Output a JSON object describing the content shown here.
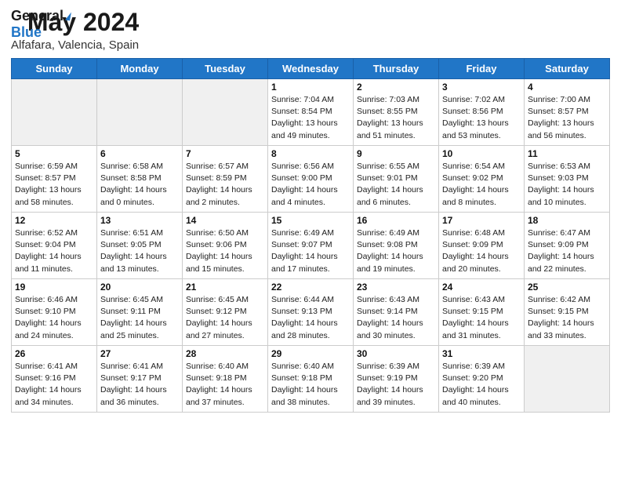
{
  "header": {
    "logo_general": "General",
    "logo_blue": "Blue",
    "title": "May 2024",
    "subtitle": "Alfafara, Valencia, Spain"
  },
  "calendar": {
    "days_of_week": [
      "Sunday",
      "Monday",
      "Tuesday",
      "Wednesday",
      "Thursday",
      "Friday",
      "Saturday"
    ],
    "weeks": [
      [
        {
          "day": "",
          "info": ""
        },
        {
          "day": "",
          "info": ""
        },
        {
          "day": "",
          "info": ""
        },
        {
          "day": "1",
          "info": "Sunrise: 7:04 AM\nSunset: 8:54 PM\nDaylight: 13 hours\nand 49 minutes."
        },
        {
          "day": "2",
          "info": "Sunrise: 7:03 AM\nSunset: 8:55 PM\nDaylight: 13 hours\nand 51 minutes."
        },
        {
          "day": "3",
          "info": "Sunrise: 7:02 AM\nSunset: 8:56 PM\nDaylight: 13 hours\nand 53 minutes."
        },
        {
          "day": "4",
          "info": "Sunrise: 7:00 AM\nSunset: 8:57 PM\nDaylight: 13 hours\nand 56 minutes."
        }
      ],
      [
        {
          "day": "5",
          "info": "Sunrise: 6:59 AM\nSunset: 8:57 PM\nDaylight: 13 hours\nand 58 minutes."
        },
        {
          "day": "6",
          "info": "Sunrise: 6:58 AM\nSunset: 8:58 PM\nDaylight: 14 hours\nand 0 minutes."
        },
        {
          "day": "7",
          "info": "Sunrise: 6:57 AM\nSunset: 8:59 PM\nDaylight: 14 hours\nand 2 minutes."
        },
        {
          "day": "8",
          "info": "Sunrise: 6:56 AM\nSunset: 9:00 PM\nDaylight: 14 hours\nand 4 minutes."
        },
        {
          "day": "9",
          "info": "Sunrise: 6:55 AM\nSunset: 9:01 PM\nDaylight: 14 hours\nand 6 minutes."
        },
        {
          "day": "10",
          "info": "Sunrise: 6:54 AM\nSunset: 9:02 PM\nDaylight: 14 hours\nand 8 minutes."
        },
        {
          "day": "11",
          "info": "Sunrise: 6:53 AM\nSunset: 9:03 PM\nDaylight: 14 hours\nand 10 minutes."
        }
      ],
      [
        {
          "day": "12",
          "info": "Sunrise: 6:52 AM\nSunset: 9:04 PM\nDaylight: 14 hours\nand 11 minutes."
        },
        {
          "day": "13",
          "info": "Sunrise: 6:51 AM\nSunset: 9:05 PM\nDaylight: 14 hours\nand 13 minutes."
        },
        {
          "day": "14",
          "info": "Sunrise: 6:50 AM\nSunset: 9:06 PM\nDaylight: 14 hours\nand 15 minutes."
        },
        {
          "day": "15",
          "info": "Sunrise: 6:49 AM\nSunset: 9:07 PM\nDaylight: 14 hours\nand 17 minutes."
        },
        {
          "day": "16",
          "info": "Sunrise: 6:49 AM\nSunset: 9:08 PM\nDaylight: 14 hours\nand 19 minutes."
        },
        {
          "day": "17",
          "info": "Sunrise: 6:48 AM\nSunset: 9:09 PM\nDaylight: 14 hours\nand 20 minutes."
        },
        {
          "day": "18",
          "info": "Sunrise: 6:47 AM\nSunset: 9:09 PM\nDaylight: 14 hours\nand 22 minutes."
        }
      ],
      [
        {
          "day": "19",
          "info": "Sunrise: 6:46 AM\nSunset: 9:10 PM\nDaylight: 14 hours\nand 24 minutes."
        },
        {
          "day": "20",
          "info": "Sunrise: 6:45 AM\nSunset: 9:11 PM\nDaylight: 14 hours\nand 25 minutes."
        },
        {
          "day": "21",
          "info": "Sunrise: 6:45 AM\nSunset: 9:12 PM\nDaylight: 14 hours\nand 27 minutes."
        },
        {
          "day": "22",
          "info": "Sunrise: 6:44 AM\nSunset: 9:13 PM\nDaylight: 14 hours\nand 28 minutes."
        },
        {
          "day": "23",
          "info": "Sunrise: 6:43 AM\nSunset: 9:14 PM\nDaylight: 14 hours\nand 30 minutes."
        },
        {
          "day": "24",
          "info": "Sunrise: 6:43 AM\nSunset: 9:15 PM\nDaylight: 14 hours\nand 31 minutes."
        },
        {
          "day": "25",
          "info": "Sunrise: 6:42 AM\nSunset: 9:15 PM\nDaylight: 14 hours\nand 33 minutes."
        }
      ],
      [
        {
          "day": "26",
          "info": "Sunrise: 6:41 AM\nSunset: 9:16 PM\nDaylight: 14 hours\nand 34 minutes."
        },
        {
          "day": "27",
          "info": "Sunrise: 6:41 AM\nSunset: 9:17 PM\nDaylight: 14 hours\nand 36 minutes."
        },
        {
          "day": "28",
          "info": "Sunrise: 6:40 AM\nSunset: 9:18 PM\nDaylight: 14 hours\nand 37 minutes."
        },
        {
          "day": "29",
          "info": "Sunrise: 6:40 AM\nSunset: 9:18 PM\nDaylight: 14 hours\nand 38 minutes."
        },
        {
          "day": "30",
          "info": "Sunrise: 6:39 AM\nSunset: 9:19 PM\nDaylight: 14 hours\nand 39 minutes."
        },
        {
          "day": "31",
          "info": "Sunrise: 6:39 AM\nSunset: 9:20 PM\nDaylight: 14 hours\nand 40 minutes."
        },
        {
          "day": "",
          "info": ""
        }
      ]
    ]
  }
}
